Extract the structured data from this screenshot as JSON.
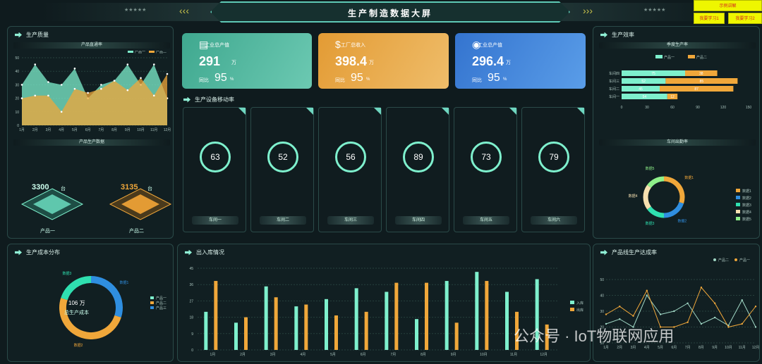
{
  "header": {
    "title": "生产制造数据大屏",
    "stars_left": "★★★★★",
    "stars_right": "★★★★★"
  },
  "buttons": {
    "example": "示例讲解",
    "learn1": "我要学习1",
    "learn2": "我要学习2"
  },
  "quality": {
    "title": "生产质量",
    "sub": "产品直通率",
    "legend": [
      "产品一",
      "产品二"
    ]
  },
  "output": {
    "title": "产品生产数据",
    "sub": "产品生产数据",
    "p1": {
      "value": "3300",
      "unit": "台",
      "name": "产品一"
    },
    "p2": {
      "value": "3135",
      "unit": "台",
      "name": "产品二"
    }
  },
  "cards": [
    {
      "label": "工业总产值",
      "value": "291",
      "unit": "万",
      "yoy_label": "同比",
      "yoy": "95",
      "yoy_unit": "%",
      "color": "#46b39a"
    },
    {
      "label": "工厂总收入",
      "value": "398.4",
      "unit": "万",
      "yoy_label": "同比",
      "yoy": "95",
      "yoy_unit": "%",
      "color": "#e8a43c"
    },
    {
      "label": "工业总产值",
      "value": "296.4",
      "unit": "万",
      "yoy_label": "同比",
      "yoy": "95",
      "yoy_unit": "%",
      "color": "#3e7fd8"
    }
  ],
  "devices": {
    "title": "生产设备移动率",
    "items": [
      {
        "value": "63",
        "label": "车间一"
      },
      {
        "value": "52",
        "label": "车间二"
      },
      {
        "value": "56",
        "label": "车间三"
      },
      {
        "value": "89",
        "label": "车间四"
      },
      {
        "value": "73",
        "label": "车间五"
      },
      {
        "value": "79",
        "label": "车间六"
      }
    ]
  },
  "efficiency": {
    "title": "生产效率",
    "sub": "季度生产率",
    "legend": [
      "产品一",
      "产品二"
    ]
  },
  "workshop_out": {
    "title": "车间出勤率",
    "legend": [
      "数据1",
      "数据2",
      "数据3",
      "数据4",
      "数据5"
    ]
  },
  "cost": {
    "title": "生产成本分布",
    "center_value": "106",
    "center_unit": "万",
    "center_label": "总生产成本",
    "legend": [
      "产品一",
      "产品二",
      "产品三"
    ],
    "slice_labels": [
      "数据1",
      "数据2",
      "数据3"
    ]
  },
  "warehouse": {
    "title": "出入库情况",
    "legend": [
      "入库",
      "出库"
    ]
  },
  "line_rate": {
    "title": "产品线生产达成率",
    "legend": [
      "产品二",
      "产品一"
    ]
  },
  "watermark": "公众号 · IoT物联网应用",
  "chart_data": [
    {
      "type": "area",
      "title": "产品直通率",
      "categories": [
        "1月",
        "2月",
        "3月",
        "4月",
        "5月",
        "6月",
        "7月",
        "8月",
        "9月",
        "10月",
        "11月",
        "12月"
      ],
      "ylim": [
        0,
        50
      ],
      "series": [
        {
          "name": "产品一",
          "values": [
            30,
            45,
            32,
            30,
            42,
            20,
            30,
            33,
            45,
            30,
            45,
            20
          ]
        },
        {
          "name": "产品二",
          "values": [
            20,
            22,
            22,
            10,
            27,
            24,
            27,
            33,
            26,
            35,
            22,
            38
          ]
        }
      ]
    },
    {
      "type": "bar",
      "title": "季度生产率",
      "categories": [
        "车间四",
        "车间三",
        "车间二",
        "车间一"
      ],
      "xlim": [
        0,
        150
      ],
      "series": [
        {
          "name": "产品一",
          "values": [
            75,
            52,
            45,
            54
          ]
        },
        {
          "name": "产品二",
          "values": [
            38,
            85,
            87,
            12
          ]
        }
      ]
    },
    {
      "type": "pie",
      "title": "车间出勤率",
      "series": [
        {
          "name": "数据1",
          "value": 30
        },
        {
          "name": "数据2",
          "value": 20
        },
        {
          "name": "数据3",
          "value": 15
        },
        {
          "name": "数据4",
          "value": 20
        },
        {
          "name": "数据5",
          "value": 15
        }
      ]
    },
    {
      "type": "pie",
      "title": "生产成本分布",
      "series": [
        {
          "name": "数据1",
          "value": 30
        },
        {
          "name": "数据2",
          "value": 50
        },
        {
          "name": "数据3",
          "value": 20
        }
      ]
    },
    {
      "type": "bar",
      "title": "出入库情况",
      "categories": [
        "1月",
        "2月",
        "3月",
        "4月",
        "5月",
        "6月",
        "7月",
        "8月",
        "9月",
        "10月",
        "11月",
        "12月"
      ],
      "ylim": [
        0,
        45
      ],
      "yticks": [
        0,
        9,
        18,
        27,
        36,
        45
      ],
      "series": [
        {
          "name": "入库",
          "values": [
            21,
            15,
            35,
            24,
            28,
            34,
            32,
            17,
            38,
            43,
            32,
            39
          ]
        },
        {
          "name": "出库",
          "values": [
            38,
            18,
            29,
            25,
            19,
            21,
            37,
            37,
            15,
            38,
            21,
            14
          ]
        }
      ]
    },
    {
      "type": "line",
      "title": "产品线生产达成率",
      "categories": [
        "1月",
        "2月",
        "3月",
        "4月",
        "5月",
        "6月",
        "7月",
        "8月",
        "9月",
        "10月",
        "11月",
        "12月"
      ],
      "ylim": [
        10,
        50
      ],
      "series": [
        {
          "name": "产品二",
          "values": [
            22,
            25,
            20,
            40,
            28,
            30,
            35,
            22,
            26,
            21,
            37,
            20
          ]
        },
        {
          "name": "产品一",
          "values": [
            28,
            33,
            27,
            43,
            20,
            20,
            23,
            45,
            35,
            20,
            22,
            33
          ]
        }
      ]
    }
  ],
  "colors": {
    "teal": "#7ef0cd",
    "orange": "#f0a73a",
    "blue": "#2f8ee0",
    "bg": "#0f1b1e"
  }
}
